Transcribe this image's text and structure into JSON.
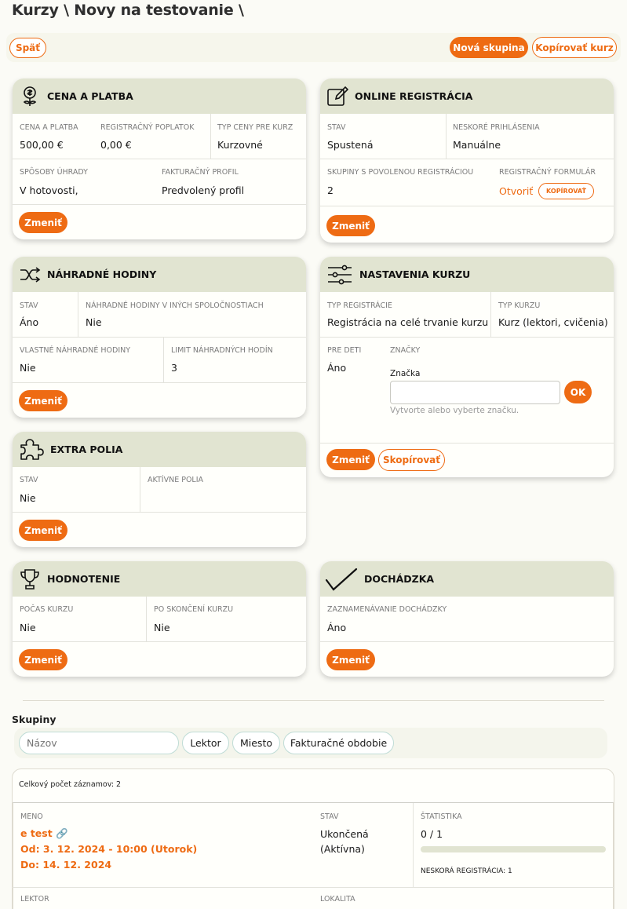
{
  "breadcrumb": "Kurzy \\ Novy na testovanie \\",
  "toolbar": {
    "back": "Späť",
    "new_group": "Nová skupina",
    "copy_course": "Kopírovať kurz"
  },
  "common": {
    "change": "Zmeniť"
  },
  "price": {
    "title": "CENA A PLATBA",
    "price_label": "CENA A PLATBA",
    "price_value": "500,00 €",
    "fee_label": "REGISTRAČNÝ POPLATOK",
    "fee_value": "0,00 €",
    "type_label": "TYP CENY PRE KURZ",
    "type_value": "Kurzovné",
    "methods_label": "SPÔSOBY ÚHRADY",
    "methods_value": "V hotovosti,",
    "invoice_label": "FAKTURAČNÝ PROFIL",
    "invoice_value": "Predvolený profil"
  },
  "online": {
    "title": "ONLINE REGISTRÁCIA",
    "state_label": "STAV",
    "state_value": "Spustená",
    "late_label": "NESKORÉ PRIHLÁSENIA",
    "late_value": "Manuálne",
    "groups_label": "SKUPINY S POVOLENOU REGISTRÁCIOU",
    "groups_value": "2",
    "form_label": "REGISTRAČNÝ FORMULÁR",
    "form_open": "Otvoriť",
    "form_copy": "KOPÍROVAŤ"
  },
  "makeup": {
    "title": "NÁHRADNÉ HODINY",
    "state_label": "STAV",
    "state_value": "Áno",
    "other_label": "NÁHRADNÉ HODINY V INÝCH SPOLOČNOSTIACH",
    "other_value": "Nie",
    "own_label": "VLASTNÉ NÁHRADNÉ HODINY",
    "own_value": "Nie",
    "limit_label": "LIMIT NÁHRADNÝCH HODÍN",
    "limit_value": "3"
  },
  "settings": {
    "title": "NASTAVENIA KURZU",
    "regtype_label": "TYP REGISTRÁCIE",
    "regtype_value": "Registrácia na celé trvanie kurzu",
    "coursetype_label": "TYP KURZU",
    "coursetype_value": "Kurz (lektori, cvičenia)",
    "kids_label": "PRE DETI",
    "kids_value": "Áno",
    "tags_label": "ZNAČKY",
    "tag_field_label": "Značka",
    "tag_field_value": "",
    "tag_ok": "OK",
    "tag_hint": "Vytvorte alebo vyberte značku.",
    "copy": "Skopírovať"
  },
  "extra": {
    "title": "EXTRA POLIA",
    "state_label": "STAV",
    "state_value": "Nie",
    "active_label": "AKTÍVNE POLIA",
    "active_value": ""
  },
  "rating": {
    "title": "HODNOTENIE",
    "during_label": "POČAS KURZU",
    "during_value": "Nie",
    "after_label": "PO SKONČENÍ KURZU",
    "after_value": "Nie"
  },
  "attendance": {
    "title": "DOCHÁDZKA",
    "rec_label": "ZAZNAMENÁVANIE DOCHÁDZKY",
    "rec_value": "Áno"
  },
  "groups": {
    "heading": "Skupiny",
    "search_placeholder": "Názov",
    "filters": [
      "Lektor",
      "Miesto",
      "Fakturačné obdobie"
    ],
    "total": "Celkový počet záznamov: 2",
    "row": {
      "name_label": "MENO",
      "name": "e test",
      "from": "Od: 3. 12. 2024 - 10:00 (Utorok)",
      "to": "Do: 14. 12. 2024",
      "state_label": "STAV",
      "state_line1": "Ukončená",
      "state_line2": "(Aktívna)",
      "stats_label": "ŠTATISTIKA",
      "stats_value": "0 / 1",
      "stats_progress": 0,
      "late_label": "NESKORÁ REGISTRÁCIA: 1",
      "lector_label": "LEKTOR",
      "location_label": "LOKALITA"
    }
  },
  "colors": {
    "accent": "#ee6b13",
    "card_header": "#e1e4d1",
    "background": "#fbfbf6"
  }
}
